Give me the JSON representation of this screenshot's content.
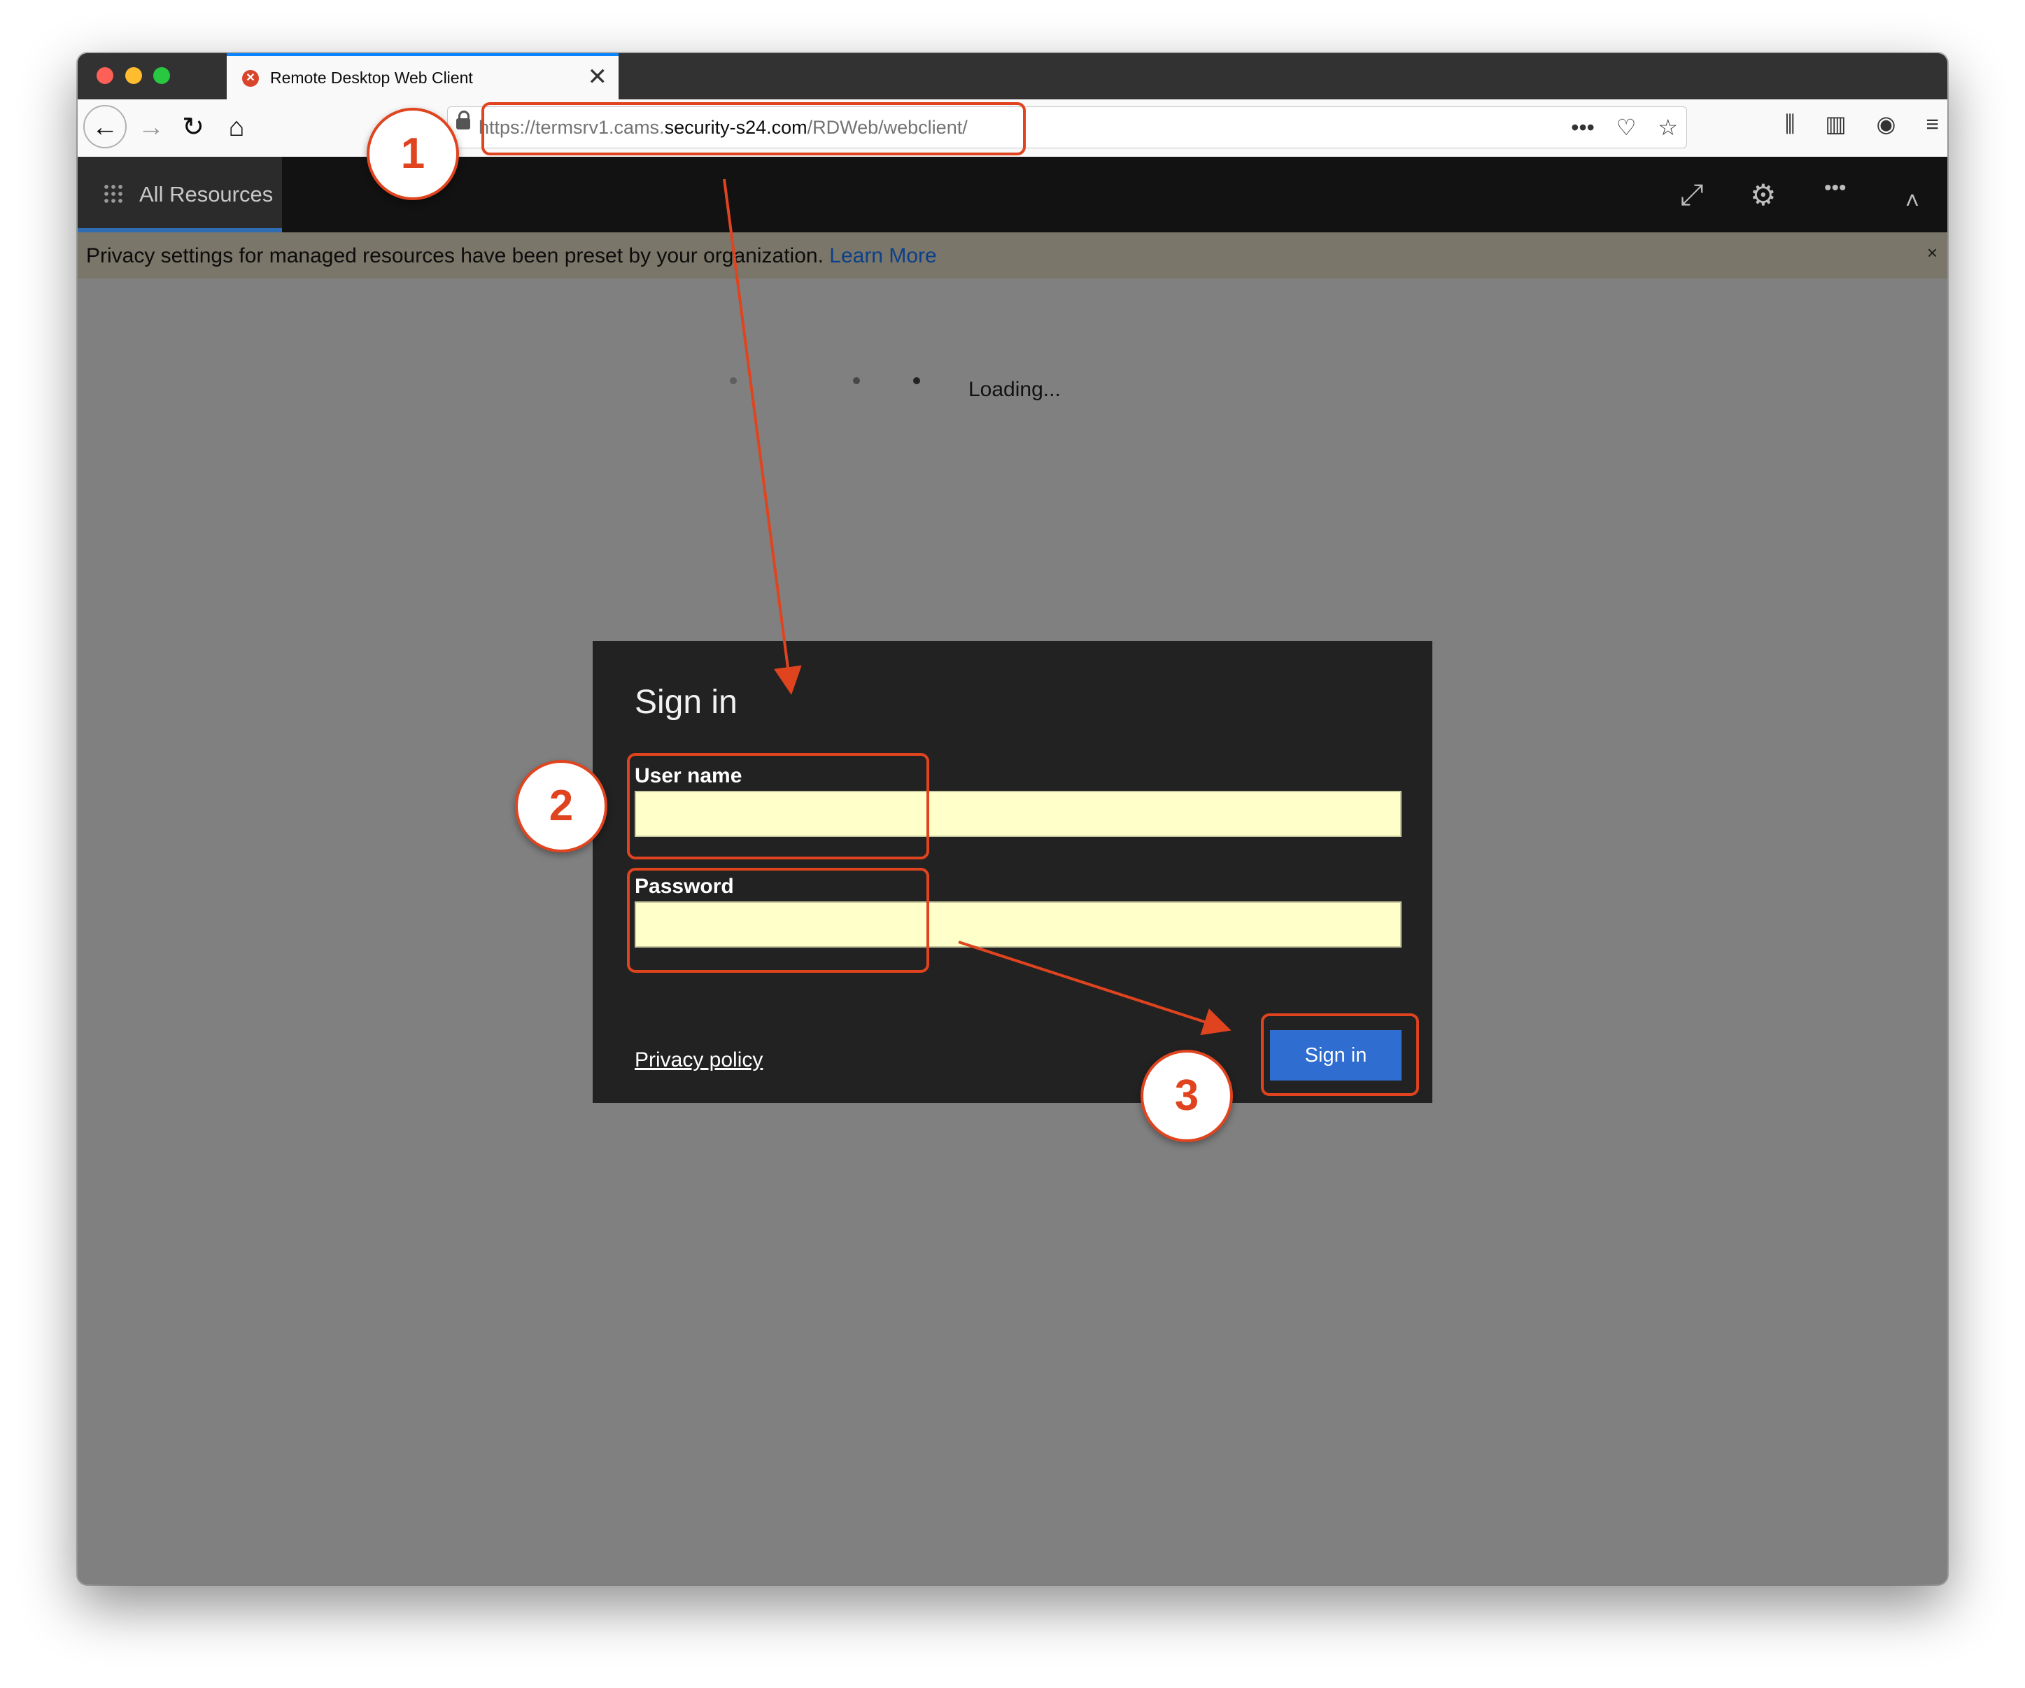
{
  "browser": {
    "tab_title": "Remote Desktop Web Client",
    "tab_close": "✕",
    "new_tab": "+",
    "url_prefix": "https://termsrv1.cams.",
    "url_domain": "security-s24.com",
    "url_path": "/RDWeb/webclient/",
    "nav_back": "←",
    "nav_forward": "→",
    "nav_reload": "↻",
    "nav_home": "⌂",
    "page_actions": "•••",
    "pocket": "♡",
    "bookmark_star": "☆",
    "library": "⫼",
    "sidebar": "▥",
    "account": "◉",
    "menu": "≡"
  },
  "app": {
    "all_resources_label": "All Resources",
    "fullscreen_icon": "⤢",
    "settings_icon": "⚙",
    "more_icon": "•••",
    "collapse_icon": "˄"
  },
  "banner": {
    "text": "Privacy settings for managed resources have been preset by your organization.",
    "link": "Learn More",
    "close": "×"
  },
  "loading_text": "Loading...",
  "dialog": {
    "title": "Sign in",
    "username_label": "User name",
    "username_value": "",
    "password_label": "Password",
    "password_value": "",
    "privacy_link": "Privacy policy",
    "submit_label": "Sign in"
  },
  "annotations": {
    "step1": "1",
    "step2": "2",
    "step3": "3",
    "color": "#e0441f"
  }
}
